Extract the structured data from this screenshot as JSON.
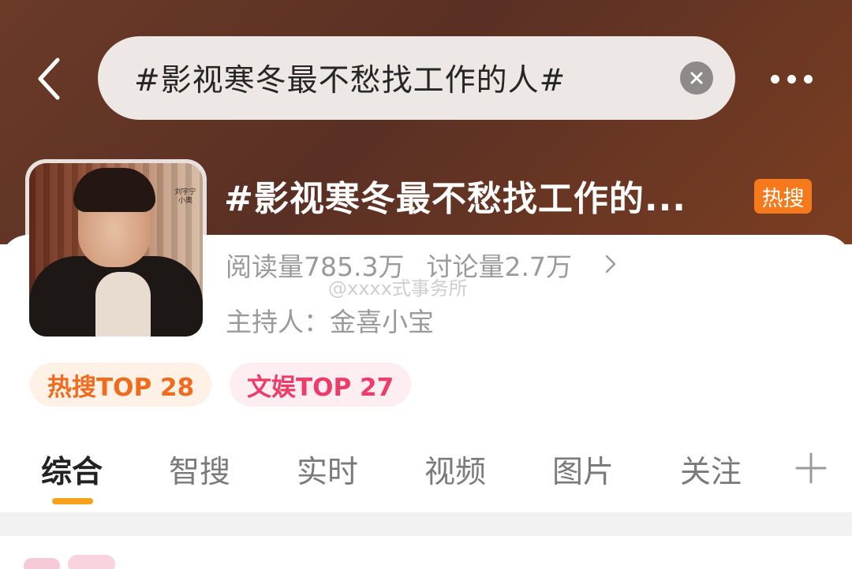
{
  "header": {
    "search_query": "#影视寒冬最不愁找工作的人#"
  },
  "topic": {
    "title": "#影视寒冬最不愁找工作的...",
    "badge": "热搜",
    "read_count": "阅读量785.3万",
    "discuss_count": "讨论量2.7万",
    "host_label": "主持人：",
    "host_name": "金喜小宝",
    "cover_caption": "刘宇宁 小奥"
  },
  "watermark": "@xxxx式事务所",
  "rank_chips": [
    {
      "label": "热搜TOP 28"
    },
    {
      "label": "文娱TOP 27"
    }
  ],
  "tabs": [
    {
      "label": "综合"
    },
    {
      "label": "智搜"
    },
    {
      "label": "实时"
    },
    {
      "label": "视频"
    },
    {
      "label": "图片"
    },
    {
      "label": "关注"
    }
  ],
  "colors": {
    "accent": "#f6a21c",
    "hot_badge": "#f6791c",
    "hot_chip_text": "#ef6b1e",
    "ent_chip_text": "#ec3d6a"
  },
  "icons": {
    "back": "chevron-left-icon",
    "clear": "close-icon",
    "more": "more-dots-icon",
    "add_tab": "plus-icon"
  }
}
